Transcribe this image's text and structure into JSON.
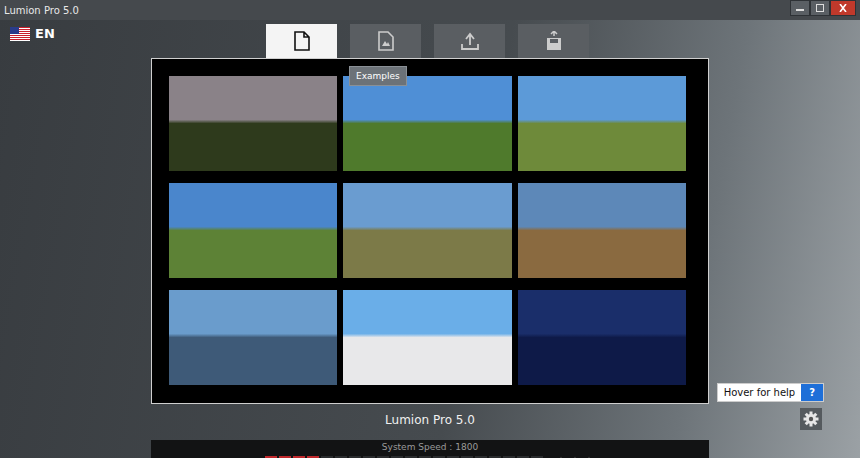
{
  "window": {
    "title": "Lumion Pro 5.0"
  },
  "language": {
    "code": "EN"
  },
  "tabs": [
    {
      "kind": "new",
      "selected": true
    },
    {
      "kind": "examples",
      "selected": false
    },
    {
      "kind": "import",
      "selected": false
    },
    {
      "kind": "save",
      "selected": false
    }
  ],
  "tooltip": {
    "text": "Examples"
  },
  "scenes": [
    {
      "sky": "#8a8288",
      "ground": "#2e3a1c"
    },
    {
      "sky": "#4f8fd6",
      "ground": "#4f7a2c"
    },
    {
      "sky": "#5c9ad8",
      "ground": "#6e8a3a"
    },
    {
      "sky": "#4a86cc",
      "ground": "#5d8236"
    },
    {
      "sky": "#6a9cd0",
      "ground": "#7c7a48"
    },
    {
      "sky": "#5d88b8",
      "ground": "#8a6a40"
    },
    {
      "sky": "#6a9ccc",
      "ground": "#3e5a78"
    },
    {
      "sky": "#6aaee8",
      "ground": "#e8e8ea"
    },
    {
      "sky": "#1a2e6a",
      "ground": "#0e1a48"
    }
  ],
  "product_label": "Lumion Pro 5.0",
  "help": {
    "text": "Hover for help",
    "button": "?"
  },
  "system_speed": {
    "label": "System Speed : 1800",
    "level": 0.2,
    "stars": 0,
    "max_stars": 3
  }
}
